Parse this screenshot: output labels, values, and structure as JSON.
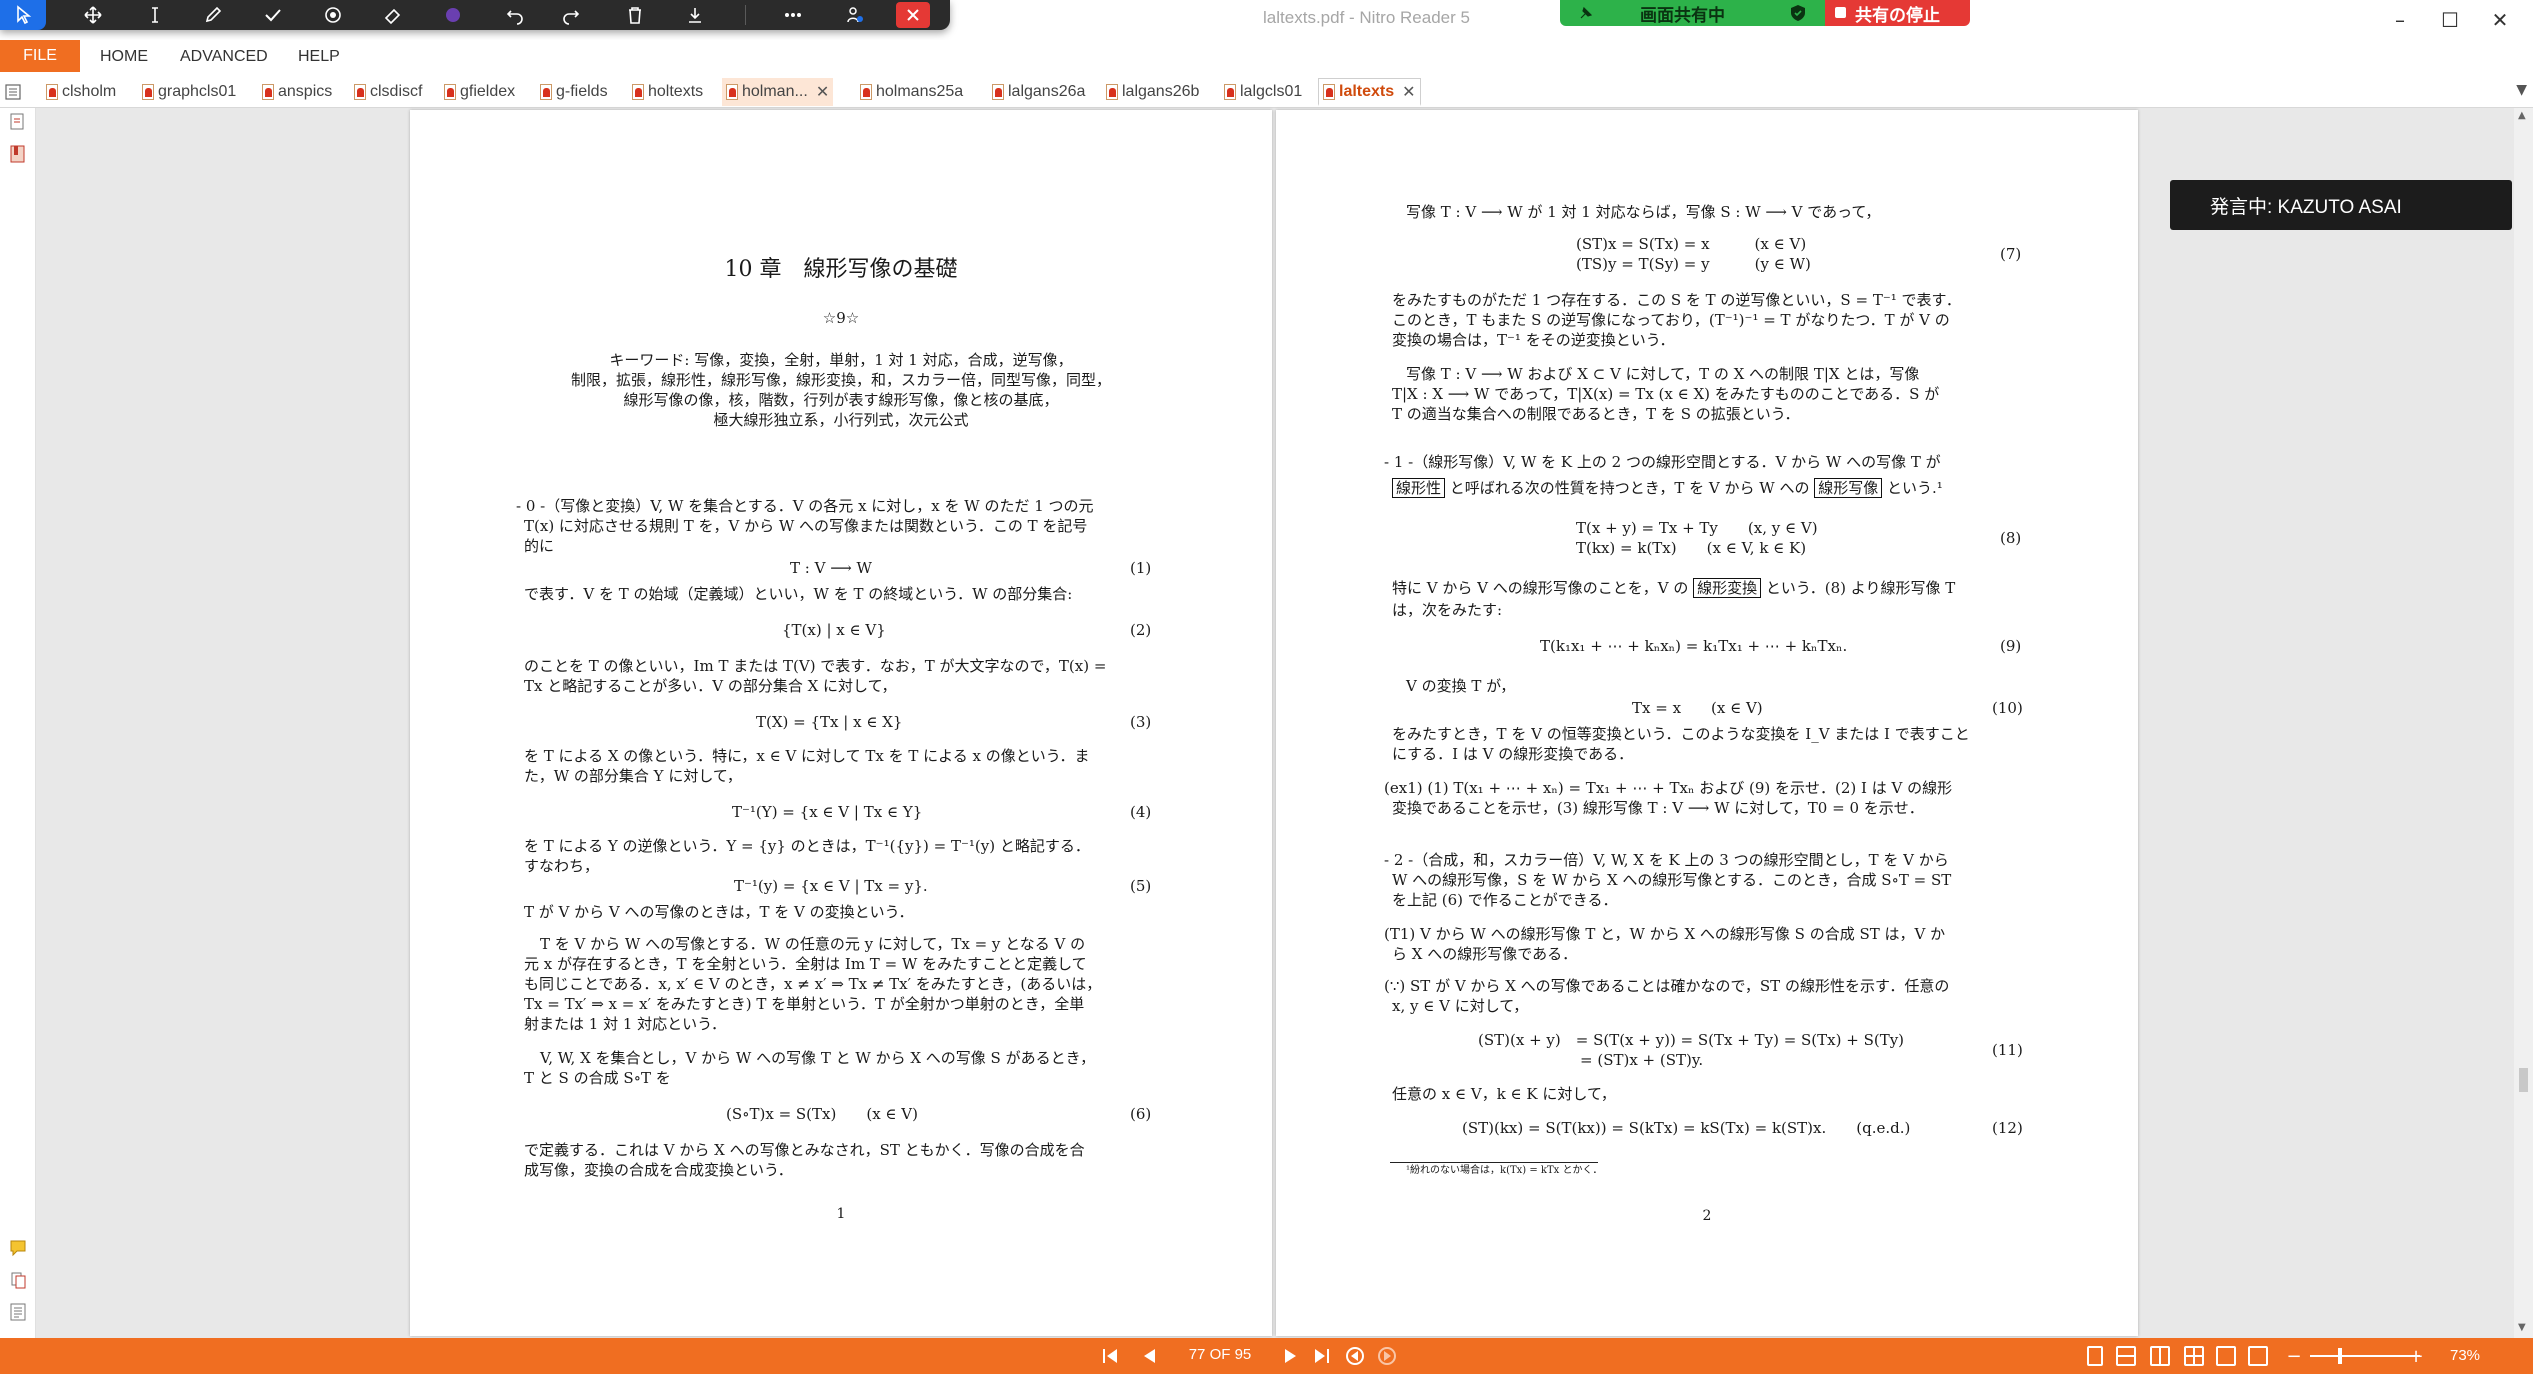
{
  "window": {
    "title": "laltexts.pdf - Nitro Reader 5",
    "minimize_glyph": "–",
    "maximize_glyph": "☐",
    "close_glyph": "✕"
  },
  "share": {
    "status_label": "画面共有中",
    "stop_label": "共有の停止",
    "on_color": "#2db24a",
    "stop_color": "#e53935"
  },
  "floating_toolbar": {
    "icons": [
      "select-arrow-icon",
      "move-icon",
      "text-cursor-icon",
      "pen-icon",
      "check-icon",
      "stamp-icon",
      "eraser-icon",
      "color-dot-icon",
      "undo-icon",
      "redo-icon",
      "trash-icon",
      "download-icon",
      "more-icon",
      "share-icon",
      "close-icon"
    ],
    "color_dot": "#6a3fb0",
    "accent": "#1e6fe8"
  },
  "menu": {
    "file": "FILE",
    "items": [
      "HOME",
      "ADVANCED",
      "HELP"
    ]
  },
  "tabs": [
    {
      "label": "clsholm"
    },
    {
      "label": "graphcls01"
    },
    {
      "label": "anspics"
    },
    {
      "label": "clsdiscf"
    },
    {
      "label": "gfieldex"
    },
    {
      "label": "g-fields"
    },
    {
      "label": "holtexts"
    },
    {
      "label": "holman...",
      "close": "✕"
    },
    {
      "label": "holmans25a"
    },
    {
      "label": "lalgans26a"
    },
    {
      "label": "lalgans26b"
    },
    {
      "label": "lalgcls01"
    },
    {
      "label": "laltexts",
      "close": "✕"
    }
  ],
  "speaker": {
    "label": "発言中: KAZUTO ASAI"
  },
  "page1": {
    "title": "10 章　線形写像の基礎",
    "subtitle": "☆9☆",
    "keywords": [
      "キーワード: 写像，変換，全射，単射，1 対 1 対応，合成，逆写像，",
      "制限，拡張，線形性，線形写像，線形変換，和，スカラー倍，同型写像，同型，",
      "線形写像の像，核，階数，行列が表す線形写像，像と核の基底，",
      "極大線形独立系，小行列式，次元公式"
    ],
    "para0": [
      "- 0 -（写像と変換）V, W を集合とする．V の各元 x に対し，x を W のただ 1 つの元",
      "T(x) に対応させる規則 T を，V から W への写像または関数という．この T を記号",
      "的に"
    ],
    "eq1": "T : V ⟶ W",
    "eq1_no": "(1)",
    "para1": "で表す．V を T の始域（定義域）といい，W を T の終域という．W の部分集合:",
    "eq2": "{T(x) | x ∈ V}",
    "eq2_no": "(2)",
    "para2": [
      "のことを T の像といい，Im T または T(V) で表す．なお，T が大文字なので，T(x) =",
      "Tx と略記することが多い．V の部分集合 X に対して，"
    ],
    "eq3": "T(X) = {Tx | x ∈ X}",
    "eq3_no": "(3)",
    "para3": [
      "を T による X の像という．特に，x ∈ V に対して Tx を T による x の像という．ま",
      "た，W の部分集合 Y に対して，"
    ],
    "eq4": "T⁻¹(Y) = {x ∈ V | Tx ∈ Y}",
    "eq4_no": "(4)",
    "para4": [
      "を T による Y の逆像という．Y = {y} のときは，T⁻¹({y}) = T⁻¹(y) と略記する．",
      "すなわち，"
    ],
    "eq5": "T⁻¹(y) = {x ∈ V | Tx = y}.",
    "eq5_no": "(5)",
    "para5": "T が V から V への写像のときは，T を V の変換という．",
    "para6": [
      "T を V から W への写像とする．W の任意の元 y に対して，Tx = y となる V の",
      "元 x が存在するとき，T を全射という．全射は Im T = W をみたすことと定義して",
      "も同じことである．x, x′ ∈ V のとき，x ≠ x′ ⇒ Tx ≠ Tx′ をみたすとき，(あるいは，",
      "Tx = Tx′ ⇒ x = x′ をみたすとき) T を単射という．T が全射かつ単射のとき，全単",
      "射または 1 対 1 対応という．"
    ],
    "para7": [
      "V, W, X を集合とし，V から W への写像 T と W から X への写像 S があるとき，",
      "T と S の合成 S∘T を"
    ],
    "eq6": "(S∘T)x = S(Tx)　　(x ∈ V)",
    "eq6_no": "(6)",
    "para8": [
      "で定義する．これは V から X への写像とみなされ，ST ともかく．写像の合成を合",
      "成写像，変換の合成を合成変換という．"
    ],
    "page_number": "1"
  },
  "page2": {
    "line0": "写像 T : V ⟶ W が 1 対 1 対応ならば，写像 S : W ⟶ V であって，",
    "eq7a": "(ST)x = S(Tx) = x　　　(x ∈ V)",
    "eq7b": "(TS)y = T(Sy) = y　　　(y ∈ W)",
    "eq7_no": "(7)",
    "para1": [
      "をみたすものがただ 1 つ存在する．この S を T の逆写像といい，S = T⁻¹ で表す．",
      "このとき，T もまた S の逆写像になっており，(T⁻¹)⁻¹ = T がなりたつ．T が V の",
      "変換の場合は，T⁻¹ をその逆変換という．"
    ],
    "para2": [
      "写像 T : V ⟶ W および X ⊂ V に対して，T の X への制限 T|X とは，写像",
      "T|X : X ⟶ W であって，T|X(x) = Tx (x ∈ X) をみたすもののことである．S が",
      "T の適当な集合への制限であるとき，T を S の拡張という．"
    ],
    "para3a": "- 1 -（線形写像）V, W を K 上の 2 つの線形空間とする．V から W への写像 T が",
    "para3b_pre": "と呼ばれる次の性質を持つとき，T を V から W への",
    "boxed_linearity": "線形性",
    "boxed_linear_map": "線形写像",
    "para3b_post": "という.¹",
    "eq8a": "T(x + y) = Tx + Ty　　(x, y ∈ V)",
    "eq8b": "T(kx) = k(Tx)　　(x ∈ V, k ∈ K)",
    "eq8_no": "(8)",
    "para4_pre": "特に V から V への線形写像のことを，V の",
    "boxed_linear_transform": "線形変換",
    "para4_post": "という．(8) より線形写像 T",
    "para4b": "は，次をみたす:",
    "eq9": "T(k₁x₁ + ⋯ + kₙxₙ) = k₁Tx₁ + ⋯ + kₙTxₙ.",
    "eq9_no": "(9)",
    "para5": "V の変換 T が，",
    "eq10": "Tx = x　　(x ∈ V)",
    "eq10_no": "(10)",
    "para6": [
      "をみたすとき，T を V の恒等変換という．このような変換を I_V または I で表すこと",
      "にする．I は V の線形変換である．"
    ],
    "ex1": [
      "(ex1) (1) T(x₁ + ⋯ + xₙ) = Tx₁ + ⋯ + Txₙ および (9) を示せ．(2) I は V の線形",
      "変換であることを示せ，(3) 線形写像 T : V ⟶ W に対して，T0 = 0 を示せ．"
    ],
    "para7": [
      "- 2 -（合成，和，スカラー倍）V, W, X を K 上の 3 つの線形空間とし，T を V から",
      "W への線形写像，S を W から X への線形写像とする．このとき，合成 S∘T = ST",
      "を上記 (6) で作ることができる．"
    ],
    "t1": [
      "(T1) V から W への線形写像 T と，W から X への線形写像 S の合成 ST は，V か",
      "ら X への線形写像である．"
    ],
    "proof": [
      "(∵) ST が V から X への写像であることは確かなので，ST の線形性を示す．任意の",
      "x, y ∈ V に対して，"
    ],
    "eq11a": "(ST)(x + y)　= S(T(x + y)) = S(Tx + Ty) = S(Tx) + S(Ty)",
    "eq11b": "= (ST)x + (ST)y.",
    "eq11_no": "(11)",
    "para8": "任意の x ∈ V，k ∈ K に対して，",
    "eq12": "(ST)(kx) = S(T(kx)) = S(kTx) = kS(Tx) = k(ST)x.　　(q.e.d.)",
    "eq12_no": "(12)",
    "footnote": "¹紛れのない場合は，k(Tx) = kTx とかく．",
    "page_number": "2"
  },
  "status": {
    "page_indicator": "77 OF 95",
    "zoom": "73%",
    "zoom_minus": "−",
    "zoom_plus": "+",
    "zoom_level": 0.73,
    "bar_color": "#f06e21"
  }
}
